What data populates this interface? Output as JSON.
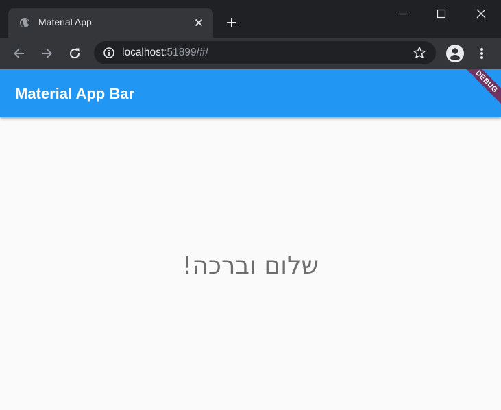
{
  "browser": {
    "tab": {
      "title": "Material App",
      "favicon": "globe-icon"
    },
    "new_tab_icon": "plus-icon",
    "window_controls": [
      "minimize-icon",
      "maximize-icon",
      "close-icon"
    ],
    "toolbar": {
      "back_icon": "arrow-left-icon",
      "forward_icon": "arrow-right-icon",
      "reload_icon": "reload-icon",
      "address": {
        "host": "localhost",
        "rest": ":51899/#/"
      },
      "bookmark_icon": "star-icon",
      "profile_icon": "account-circle-icon",
      "menu_icon": "kebab-menu-icon"
    }
  },
  "app": {
    "appbar_title": "Material App Bar",
    "appbar_color": "#2196f3",
    "greeting": "שלום וברכה!",
    "debug_banner": "DEBUG",
    "debug_banner_color": "#802040"
  }
}
